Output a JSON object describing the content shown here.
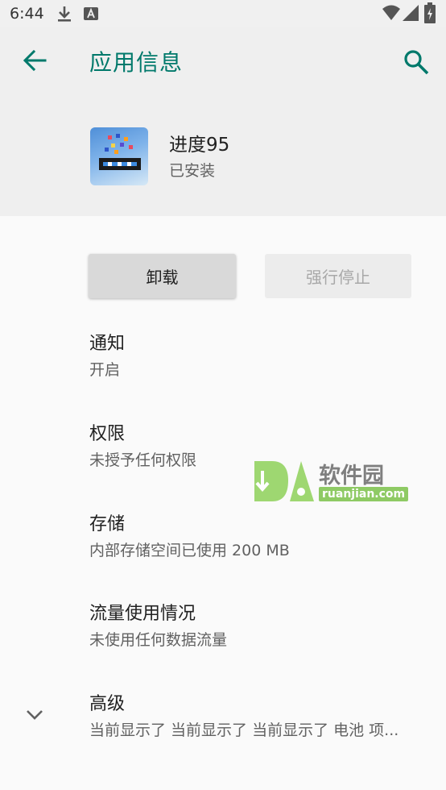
{
  "status_bar": {
    "time": "6:44",
    "icons": [
      "download-icon",
      "a-icon",
      "wifi-icon",
      "signal-icon",
      "battery-icon"
    ]
  },
  "header": {
    "title": "应用信息",
    "back_icon": "arrow-back-icon",
    "search_icon": "search-icon",
    "accent_color": "#00796b"
  },
  "app": {
    "name": "进度95",
    "status": "已安装"
  },
  "buttons": {
    "uninstall": "卸载",
    "force_stop": "强行停止"
  },
  "items": [
    {
      "title": "通知",
      "summary": "开启"
    },
    {
      "title": "权限",
      "summary": "未授予任何权限"
    },
    {
      "title": "存储",
      "summary": "内部存储空间已使用 200 MB"
    },
    {
      "title": "流量使用情况",
      "summary": "未使用任何数据流量"
    },
    {
      "title": "高级",
      "summary": "当前显示了 当前显示了 当前显示了 电池 项..."
    }
  ],
  "watermark": {
    "big": "软件园",
    "small": "ruanjian.com"
  }
}
